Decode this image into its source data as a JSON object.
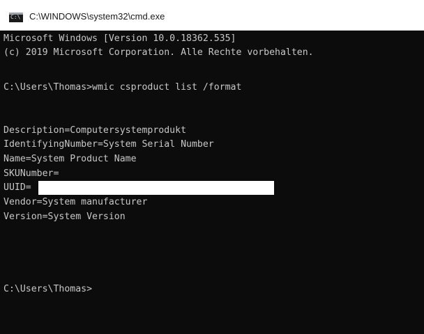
{
  "window": {
    "title": "C:\\WINDOWS\\system32\\cmd.exe",
    "icon": "cmd-icon"
  },
  "console": {
    "lines": [
      "Microsoft Windows [Version 10.0.18362.535]",
      "(c) 2019 Microsoft Corporation. Alle Rechte vorbehalten.",
      "",
      "C:\\Users\\Thomas>wmic csproduct list /format",
      "",
      "",
      "Description=Computersystemprodukt",
      "IdentifyingNumber=System Serial Number",
      "Name=System Product Name",
      "SKUNumber=",
      "UUID=",
      "Vendor=System manufacturer",
      "Version=System Version",
      "",
      "",
      "",
      "",
      "C:\\Users\\Thomas>"
    ]
  }
}
